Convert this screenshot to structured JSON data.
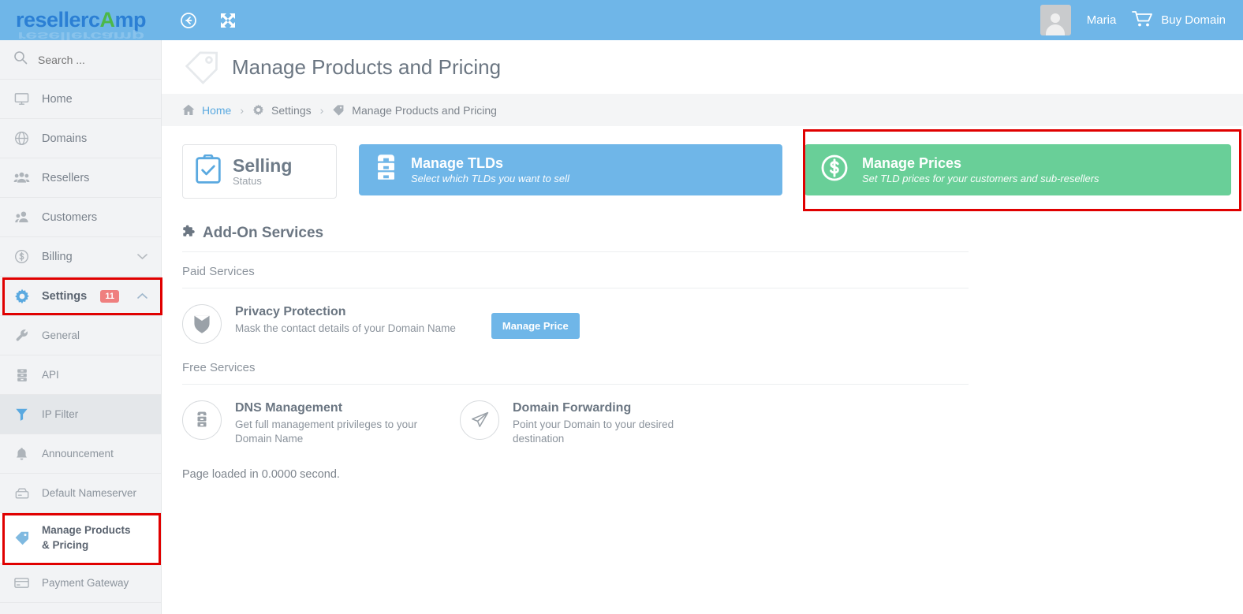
{
  "brand": {
    "logo_text_1": "resellerc",
    "logo_text_2": "A",
    "logo_text_3": "mp",
    "accent_blue": "#6fb6e8",
    "accent_green": "#69cf98",
    "accent_red": "#e00000",
    "badge_red": "#ef7f7f"
  },
  "topbar": {
    "back_icon": "back-circle-icon",
    "expand_icon": "expand-arrows-icon",
    "user_name": "Maria",
    "buy_domain_label": "Buy Domain",
    "cart_icon": "shopping-cart-icon"
  },
  "sidebar": {
    "search_placeholder": "Search ...",
    "search_value": "",
    "items": [
      {
        "label": "Home",
        "icon": "monitor-icon"
      },
      {
        "label": "Domains",
        "icon": "globe-icon"
      },
      {
        "label": "Resellers",
        "icon": "users-group-icon"
      },
      {
        "label": "Customers",
        "icon": "user-pair-icon"
      },
      {
        "label": "Billing",
        "icon": "dollar-circle-icon",
        "chevron": "chevron-down-icon"
      },
      {
        "label": "Settings",
        "icon": "gear-icon",
        "badge": "11",
        "chevron": "chevron-up-icon"
      }
    ],
    "sub_items": [
      {
        "label": "General",
        "icon": "wrench-icon"
      },
      {
        "label": "API",
        "icon": "server-icon"
      },
      {
        "label": "IP Filter",
        "icon": "funnel-icon"
      },
      {
        "label": "Announcement",
        "icon": "bell-icon"
      },
      {
        "label": "Default Nameserver",
        "icon": "nameserver-icon"
      },
      {
        "label": "Manage Products & Pricing",
        "icon": "tag-icon"
      },
      {
        "label": "Payment Gateway",
        "icon": "credit-card-icon"
      }
    ]
  },
  "page": {
    "title": "Manage Products and Pricing",
    "title_icon": "tag-icon"
  },
  "breadcrumb": {
    "home": "Home",
    "settings": "Settings",
    "current": "Manage Products and Pricing",
    "separator": "›",
    "home_icon": "home-icon",
    "settings_icon": "gear-icon",
    "current_icon": "tag-icon"
  },
  "cards": {
    "selling": {
      "title": "Selling",
      "subtitle": "Status",
      "icon": "clipboard-check-icon"
    },
    "manage_tlds": {
      "title": "Manage TLDs",
      "subtitle": "Select which TLDs you want to sell",
      "icon": "server-rack-icon"
    },
    "manage_prices": {
      "title": "Manage Prices",
      "subtitle": "Set TLD prices for your customers and sub-resellers",
      "icon": "dollar-circle-icon"
    }
  },
  "addons": {
    "section_title": "Add-On Services",
    "section_icon": "puzzle-piece-icon",
    "paid_label": "Paid Services",
    "free_label": "Free Services",
    "paid_services": [
      {
        "title": "Privacy Protection",
        "desc": "Mask the contact details of your Domain Name",
        "icon": "shield-icon",
        "button": "Manage Price"
      }
    ],
    "free_services": [
      {
        "title": "DNS Management",
        "desc": "Get full management privileges to your Domain Name",
        "icon": "server-icon"
      },
      {
        "title": "Domain Forwarding",
        "desc": "Point your Domain to your desired destination",
        "icon": "paper-plane-icon"
      }
    ]
  },
  "footer": {
    "note": "Page loaded in 0.0000 second."
  }
}
